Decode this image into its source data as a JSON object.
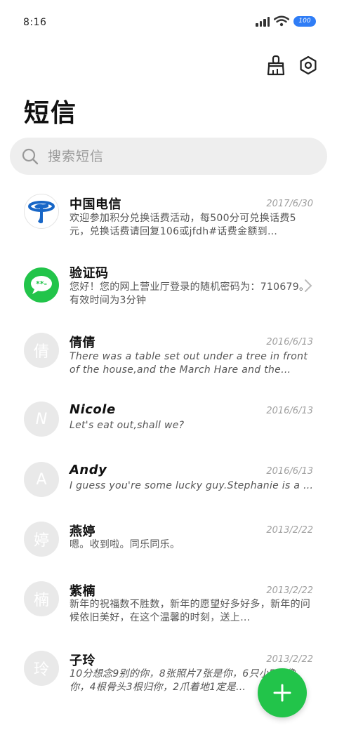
{
  "status_bar": {
    "time": "8:16",
    "battery_level": "100",
    "icons": [
      "signal-icon",
      "wifi-icon",
      "battery-icon"
    ]
  },
  "toolbar": {
    "icons": [
      "broom-icon",
      "settings-icon"
    ]
  },
  "page": {
    "title": "短信"
  },
  "search": {
    "placeholder": "搜索短信",
    "value": ""
  },
  "messages": [
    {
      "sender": "中国电信",
      "date": "2017/6/30",
      "preview": "欢迎参加积分兑换话费活动，每500分可兑换话费5元，兑换话费请回复106或jfdh#话费金额到…",
      "avatar": "china-telecom-logo"
    },
    {
      "sender": "验证码",
      "date": "",
      "preview": "您好！您的网上营业厅登录的随机密码为：710679。有效时间为3分钟",
      "avatar": "verification-code-icon"
    },
    {
      "sender": "倩倩",
      "date": "2016/6/13",
      "preview": "There was a table set out under a tree in front of the house,and the March Hare and the Hatter were having…",
      "avatar_text": "倩"
    },
    {
      "sender": "Nicole",
      "date": "2016/6/13",
      "preview": "Let's eat out,shall we?",
      "avatar_text": "N"
    },
    {
      "sender": "Andy",
      "date": "2016/6/13",
      "preview": "I guess you're some lucky guy.Stephanie is a nice girl.",
      "avatar_text": "A"
    },
    {
      "sender": "燕婷",
      "date": "2013/2/22",
      "preview": "嗯。收到啦。同乐同乐。",
      "avatar_text": "婷"
    },
    {
      "sender": "紫楠",
      "date": "2013/2/22",
      "preview": "新年的祝福数不胜数，新年的愿望好多好多，新年的问候依旧美好，在这个温馨的时刻，送上…",
      "avatar_text": "楠"
    },
    {
      "sender": "子玲",
      "date": "2013/2/22",
      "preview": "10分想念9别的你，8张照片7张是你，6只小5只像你，4根骨头3根归你，2爪着地1定是…",
      "avatar_text": "玲"
    }
  ],
  "fab": {
    "icon": "plus-icon"
  },
  "colors": {
    "accent_green": "#22c44a",
    "telecom_blue": "#1766c7",
    "battery_blue": "#2f7df6",
    "search_bg": "#eeeeee",
    "avatar_bg": "#e9e9e9"
  }
}
